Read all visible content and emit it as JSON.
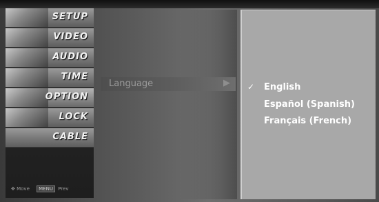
{
  "menu": {
    "items": [
      {
        "label": "SETUP",
        "icon": "setup-icon"
      },
      {
        "label": "VIDEO",
        "icon": "video-icon"
      },
      {
        "label": "AUDIO",
        "icon": "audio-icon"
      },
      {
        "label": "TIME",
        "icon": "time-icon"
      },
      {
        "label": "OPTION",
        "icon": "option-icon"
      },
      {
        "label": "LOCK",
        "icon": "lock-icon"
      },
      {
        "label": "CABLE",
        "icon": "cable-icon"
      }
    ],
    "selected_index": 4,
    "footer": {
      "move_icon": "dpad-icon",
      "move_label": "Move",
      "prev_key": "MENU",
      "prev_label": "Prev"
    }
  },
  "submenu": {
    "item_label": "Language",
    "arrow": "▶"
  },
  "options": {
    "items": [
      {
        "label": "English",
        "checked": true
      },
      {
        "label": "Español (Spanish)",
        "checked": false
      },
      {
        "label": "Français (French)",
        "checked": false
      }
    ],
    "check_glyph": "✓"
  }
}
